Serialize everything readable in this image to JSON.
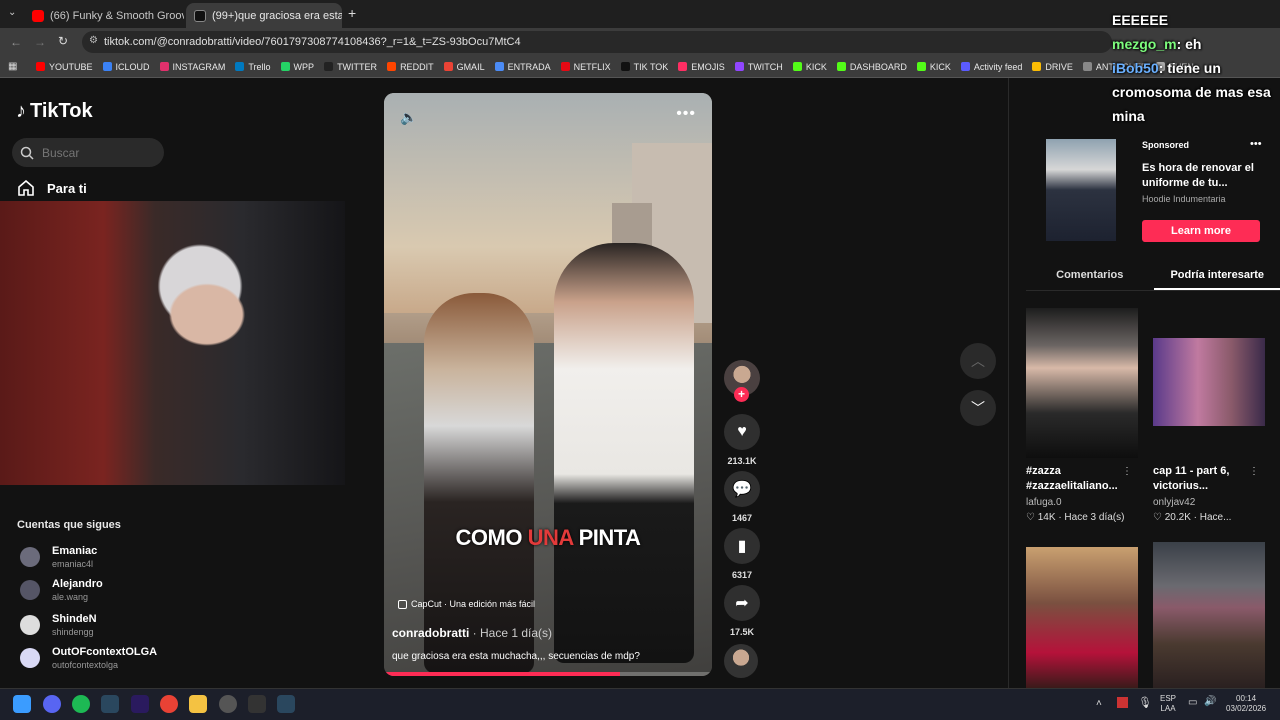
{
  "browser": {
    "tabs": [
      {
        "label": "(66) Funky & Smooth Groovy D",
        "color": "#ff0000"
      },
      {
        "label": "(99+)que graciosa era esta",
        "color": "#000000"
      }
    ],
    "url": "tiktok.com/@conradobratti/video/7601797308774108436?_r=1&_t=ZS-93bOcu7MtC4",
    "bookmarks": [
      {
        "label": "YOUTUBE",
        "color": "#ff0000"
      },
      {
        "label": "ICLOUD",
        "color": "#3b82f6"
      },
      {
        "label": "INSTAGRAM",
        "color": "#e1306c"
      },
      {
        "label": "Trello",
        "color": "#0079bf"
      },
      {
        "label": "WPP",
        "color": "#25d366"
      },
      {
        "label": "TWITTER",
        "color": "#222222"
      },
      {
        "label": "REDDIT",
        "color": "#ff4500"
      },
      {
        "label": "GMAIL",
        "color": "#ea4335"
      },
      {
        "label": "ENTRADA",
        "color": "#4b8bf5"
      },
      {
        "label": "NETFLIX",
        "color": "#e50914"
      },
      {
        "label": "TIK TOK",
        "color": "#111111"
      },
      {
        "label": "EMOJIS",
        "color": "#ff2e63"
      },
      {
        "label": "TWITCH",
        "color": "#9146ff"
      },
      {
        "label": "KICK",
        "color": "#53fc18"
      },
      {
        "label": "DASHBOARD",
        "color": "#53fc18"
      },
      {
        "label": "KICK",
        "color": "#53fc18"
      },
      {
        "label": "Activity feed",
        "color": "#5b5bff"
      },
      {
        "label": "DRIVE",
        "color": "#fbbc04"
      },
      {
        "label": "ANTISCUFF",
        "color": "#888888"
      },
      {
        "label": "FUEN",
        "color": "#aaaaaa"
      }
    ]
  },
  "sidebar": {
    "logo": "TikTok",
    "search_placeholder": "Buscar",
    "for_you": "Para ti",
    "following_title": "Cuentas que sigues",
    "accounts": [
      {
        "name": "Emaniac",
        "handle": "emaniac4l"
      },
      {
        "name": "Alejandro",
        "handle": "ale.wang"
      },
      {
        "name": "ShindeN",
        "handle": "shindengg"
      },
      {
        "name": "OutOFcontextOLGA",
        "handle": "outofcontextolga"
      }
    ]
  },
  "video": {
    "caption_a": "COMO ",
    "caption_b": "UNA",
    "caption_c": " PINTA",
    "capcut": "CapCut · Una edición más fácil",
    "author": "conradobratti",
    "time": " · Hace 1 día(s)",
    "description": "que graciosa era esta muchacha,,, secuencias de mdp?",
    "progress": 0.72
  },
  "actions": {
    "likes": "213.1K",
    "comments": "1467",
    "saves": "6317",
    "shares": "17.5K"
  },
  "ad": {
    "sponsored": "Sponsored",
    "text": "Es hora de renovar el uniforme de tu...",
    "brand": "Hoodie Indumentaria",
    "cta": "Learn more"
  },
  "right_tabs": [
    "Comentarios",
    "Podría interesarte"
  ],
  "suggestions": [
    {
      "title": "#zazza #zazzaelitaliano...",
      "user": "lafuga.0",
      "meta": "♡ 14K · Hace 3 día(s)"
    },
    {
      "title": "cap 11 - part 6, victorius...",
      "user": "onlyjav42",
      "meta": "♡ 20.2K · Hace..."
    }
  ],
  "chat": {
    "line1": "EEEEEE",
    "user1": "mezgo_m",
    "msg1": ": eh",
    "user2": "iBob50",
    "msg2": ": tiene un cromosoma de mas esa mina"
  },
  "taskbar": {
    "lang1": "ESP",
    "lang2": "LAA",
    "time": "00:14",
    "date": "03/02/2026"
  }
}
